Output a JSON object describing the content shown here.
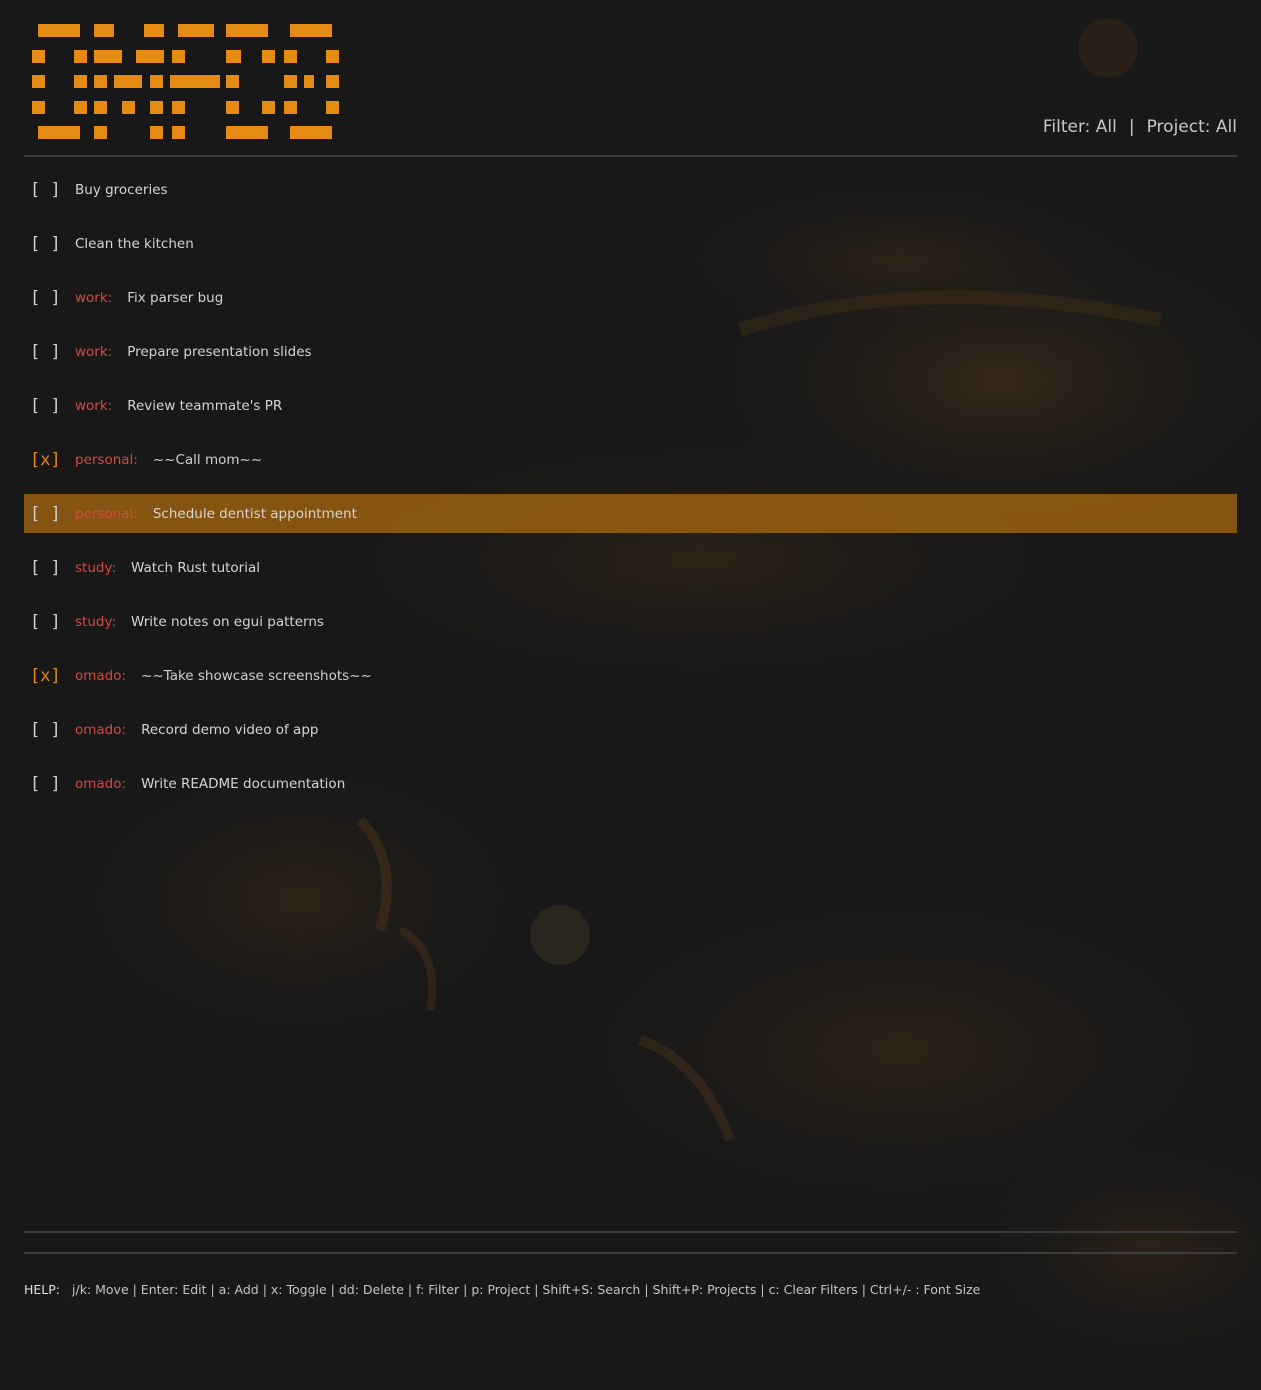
{
  "header": {
    "filter_label": "Filter:",
    "filter_value": "All",
    "separator": "|",
    "project_label": "Project:",
    "project_value": "All"
  },
  "colors": {
    "accent": "#e58a12",
    "project": "#d8483c",
    "selected_row": "#b06c0e",
    "background": "#181818"
  },
  "todos": [
    {
      "checkbox": "[ ]",
      "done": false,
      "project": "",
      "text": "Buy groceries"
    },
    {
      "checkbox": "[ ]",
      "done": false,
      "project": "",
      "text": "Clean the kitchen"
    },
    {
      "checkbox": "[ ]",
      "done": false,
      "project": "work:",
      "text": "Fix parser bug"
    },
    {
      "checkbox": "[ ]",
      "done": false,
      "project": "work:",
      "text": "Prepare presentation slides"
    },
    {
      "checkbox": "[ ]",
      "done": false,
      "project": "work:",
      "text": "Review teammate's PR"
    },
    {
      "checkbox": "[x]",
      "done": true,
      "project": "personal:",
      "text": "~~Call mom~~"
    },
    {
      "checkbox": "[ ]",
      "done": false,
      "project": "personal:",
      "text": "Schedule dentist appointment",
      "selected": true
    },
    {
      "checkbox": "[ ]",
      "done": false,
      "project": "study:",
      "text": "Watch Rust tutorial"
    },
    {
      "checkbox": "[ ]",
      "done": false,
      "project": "study:",
      "text": "Write notes on egui patterns"
    },
    {
      "checkbox": "[x]",
      "done": true,
      "project": "omado:",
      "text": "~~Take showcase screenshots~~"
    },
    {
      "checkbox": "[ ]",
      "done": false,
      "project": "omado:",
      "text": "Record demo video of app"
    },
    {
      "checkbox": "[ ]",
      "done": false,
      "project": "omado:",
      "text": "Write README documentation"
    }
  ],
  "help": {
    "label": "HELP:",
    "text": "j/k: Move | Enter: Edit | a: Add | x: Toggle | dd: Delete | f: Filter | p: Project | Shift+S: Search | Shift+P: Projects | c: Clear Filters | Ctrl+/- : Font Size"
  }
}
